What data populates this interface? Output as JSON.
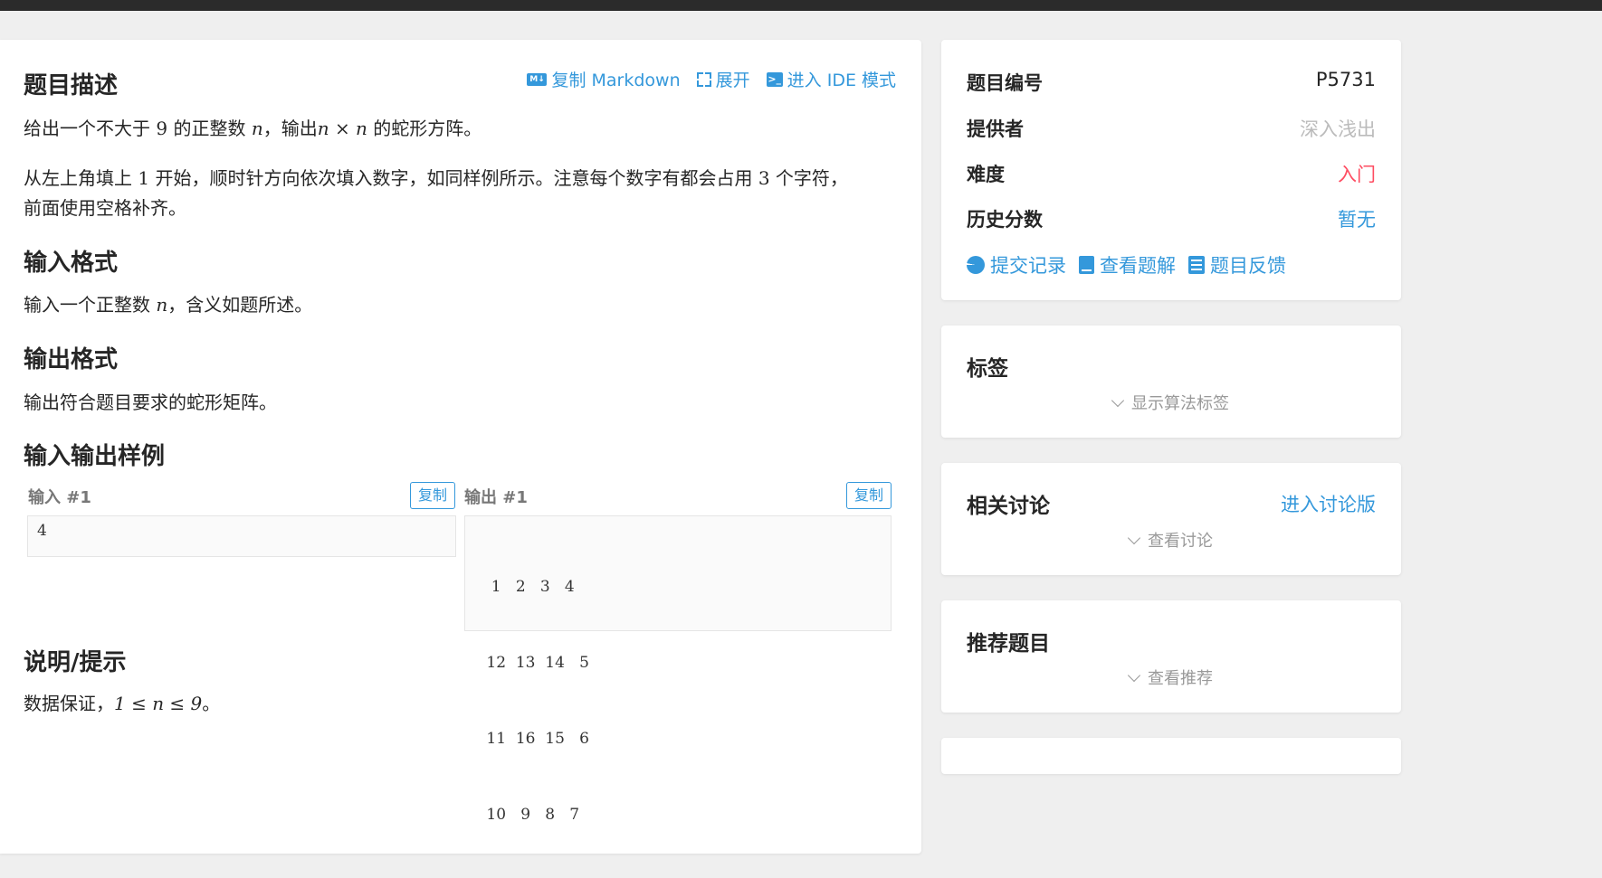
{
  "main": {
    "description": {
      "title": "题目描述",
      "actions": {
        "copy_markdown": "复制 Markdown",
        "expand": "展开",
        "ide_mode": "进入 IDE 模式"
      },
      "line1_a": "给出一个不大于",
      "line1_num": "9",
      "line1_b": "的正整数",
      "line1_var": "n",
      "line1_c": "，输出",
      "line1_expr": "n × n",
      "line1_d": "的蛇形方阵。",
      "line2_a": "从左上角填上",
      "line2_num": "1",
      "line2_b": "开始，顺时针方向依次填入数字，如同样例所示。注意每个数字有都会占用",
      "line2_num2": "3",
      "line2_c": "个字符，",
      "line3": "前面使用空格补齐。"
    },
    "input_format": {
      "title": "输入格式",
      "text_a": "输入一个正整数",
      "text_var": "n",
      "text_b": "，含义如题所述。"
    },
    "output_format": {
      "title": "输出格式",
      "text": "输出符合题目要求的蛇形矩阵。"
    },
    "samples": {
      "title": "输入输出样例",
      "input_label": "输入 #1",
      "output_label": "输出 #1",
      "copy_label": "复制",
      "input_value": "4",
      "output_rows": [
        "  1   2   3   4",
        " 12  13  14   5",
        " 11  16  15   6",
        " 10   9   8   7"
      ]
    },
    "hint": {
      "title": "说明/提示",
      "text_a": "数据保证，",
      "text_expr": "1 ≤ n ≤ 9",
      "text_b": "。"
    }
  },
  "sidebar": {
    "info": {
      "pid_label": "题目编号",
      "pid_value": "P5731",
      "provider_label": "提供者",
      "provider_value": "深入浅出",
      "difficulty_label": "难度",
      "difficulty_value": "入门",
      "history_label": "历史分数",
      "history_value": "暂无",
      "links": {
        "submissions": "提交记录",
        "solutions": "查看题解",
        "feedback": "题目反馈"
      }
    },
    "tags": {
      "title": "标签",
      "toggle": "显示算法标签"
    },
    "discuss": {
      "title": "相关讨论",
      "link": "进入讨论版",
      "toggle": "查看讨论"
    },
    "recommend": {
      "title": "推荐题目",
      "toggle": "查看推荐"
    }
  },
  "colors": {
    "accent": "#3498db",
    "difficulty_red": "#fe4c61",
    "muted": "#bbbbbb"
  }
}
